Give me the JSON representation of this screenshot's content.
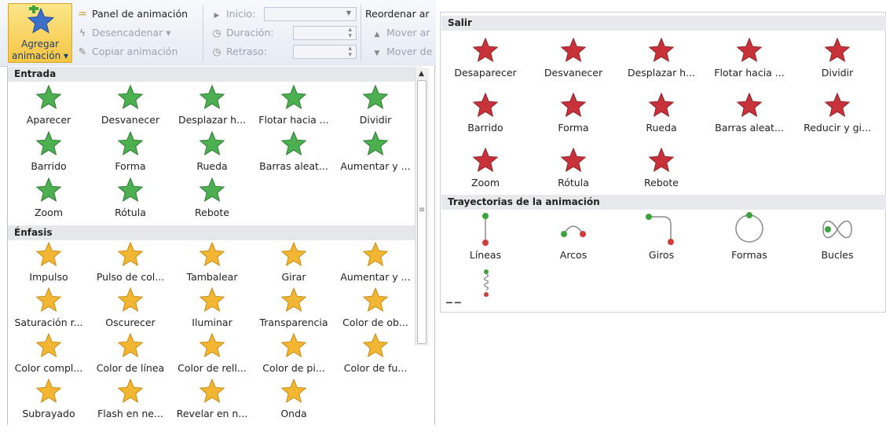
{
  "ribbon": {
    "add_animation_line1": "Agregar",
    "add_animation_line2": "animación ▾",
    "animation_pane": "Panel de animación",
    "trigger": "Desencadenar ▾",
    "copy_animation": "Copiar animación",
    "start_label": "Inicio:",
    "duration_label": "Duración:",
    "delay_label": "Retraso:",
    "reorder_label": "Reordenar ar",
    "move_earlier": "Mover ar",
    "move_later": "Mover de"
  },
  "left_panel": {
    "entrance_header": "Entrada",
    "entrance_items": [
      "Aparecer",
      "Desvanecer",
      "Desplazar h...",
      "Flotar hacia ...",
      "Dividir",
      "Barrido",
      "Forma",
      "Rueda",
      "Barras aleat...",
      "Aumentar y ...",
      "Zoom",
      "Rótula",
      "Rebote"
    ],
    "emphasis_header": "Énfasis",
    "emphasis_items": [
      "Impulso",
      "Pulso de col...",
      "Tambalear",
      "Girar",
      "Aumentar y ...",
      "Saturación r...",
      "Oscurecer",
      "Iluminar",
      "Transparencia",
      "Color de ob...",
      "Color compl...",
      "Color de línea",
      "Color de rell...",
      "Color de pi...",
      "Color de fu...",
      "Subrayado",
      "Flash en ne...",
      "Revelar en n...",
      "Onda"
    ]
  },
  "right_panel": {
    "exit_header": "Salir",
    "exit_items": [
      "Desaparecer",
      "Desvanecer",
      "Desplazar h...",
      "Flotar hacia ...",
      "Dividir",
      "Barrido",
      "Forma",
      "Rueda",
      "Barras aleat...",
      "Reducir y gi...",
      "Zoom",
      "Rótula",
      "Rebote"
    ],
    "paths_header": "Trayectorias de la animación",
    "path_items": [
      "Líneas",
      "Arcos",
      "Giros",
      "Formas",
      "Bucles"
    ]
  },
  "colors": {
    "entrance": "#4caf50",
    "emphasis": "#f2b632",
    "exit": "#c8323a",
    "header_bg": "#e5e7ea"
  },
  "icons": {
    "entrance": "green-star-icon",
    "emphasis": "gold-star-icon",
    "exit": "red-star-icon",
    "path": "motion-path-icon"
  }
}
